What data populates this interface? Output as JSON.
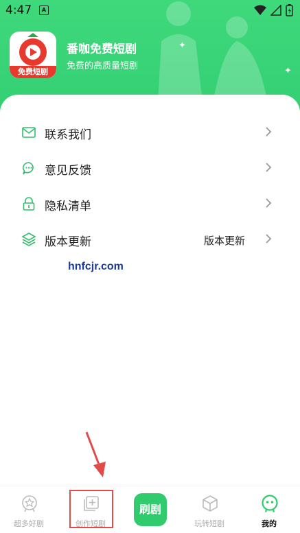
{
  "status_bar": {
    "time": "4:47",
    "a_badge": "A"
  },
  "app": {
    "name": "番咖免费短剧",
    "subtitle": "免费的高质量短剧",
    "logo_text": "免费短剧"
  },
  "menu": [
    {
      "label": "联系我们",
      "icon": "mail-icon",
      "value": ""
    },
    {
      "label": "意见反馈",
      "icon": "chat-bubble-icon",
      "value": ""
    },
    {
      "label": "隐私清单",
      "icon": "lock-icon",
      "value": ""
    },
    {
      "label": "版本更新",
      "icon": "layers-icon",
      "value": "版本更新"
    }
  ],
  "watermark": "hnfcjr.com",
  "tabs": [
    {
      "label": "超多好剧",
      "icon": "star-badge-icon",
      "active": false
    },
    {
      "label": "创作短剧",
      "icon": "add-square-icon",
      "active": false
    },
    {
      "label": "刷剧",
      "icon": "",
      "active": false
    },
    {
      "label": "玩转短剧",
      "icon": "cube-icon",
      "active": false
    },
    {
      "label": "我的",
      "icon": "profile-face-icon",
      "active": true
    }
  ],
  "colors": {
    "brand_green": "#33cf72",
    "highlight_red": "#e14b4b"
  }
}
